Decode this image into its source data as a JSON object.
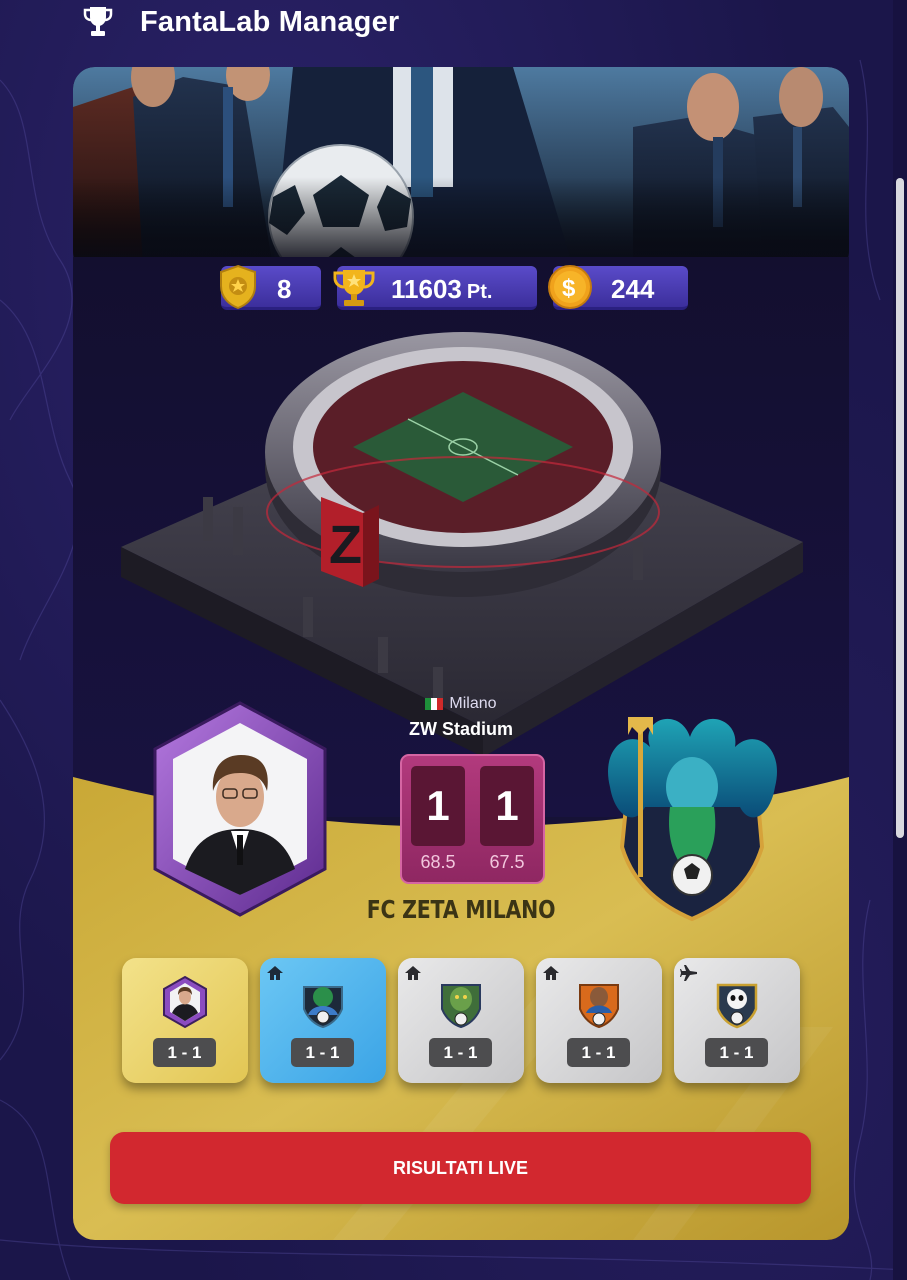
{
  "header": {
    "title": "FantaLab Manager",
    "icon": "trophy-icon"
  },
  "stats": {
    "level": "8",
    "points": "11603",
    "points_unit": "Pt.",
    "coins": "244"
  },
  "stadium": {
    "city": "Milano",
    "name": "ZW Stadium"
  },
  "score": {
    "home": "1",
    "away": "1",
    "home_rating": "68.5",
    "away_rating": "67.5"
  },
  "team": {
    "name": "FC ZETA MILANO"
  },
  "matches": [
    {
      "result": "1 - 1",
      "venue": "none",
      "style": "gold",
      "badge": "manager-portrait-badge"
    },
    {
      "result": "1 - 1",
      "venue": "home",
      "style": "blue",
      "badge": "green-warrior-crest"
    },
    {
      "result": "1 - 1",
      "venue": "home",
      "style": "silver",
      "badge": "ogre-crest"
    },
    {
      "result": "1 - 1",
      "venue": "home",
      "style": "silver",
      "badge": "fire-warrior-crest"
    },
    {
      "result": "1 - 1",
      "venue": "away",
      "style": "silver",
      "badge": "panda-crest"
    }
  ],
  "live_button": {
    "label": "RISULTATI LIVE"
  },
  "colors": {
    "background": "#1b164a",
    "card_dark": "#161236",
    "gold": "#d6b443",
    "stat_purple": "#4a3cb4",
    "score_pink": "#a2306f",
    "live_red": "#d2282f",
    "active_blue": "#4db4ee"
  }
}
